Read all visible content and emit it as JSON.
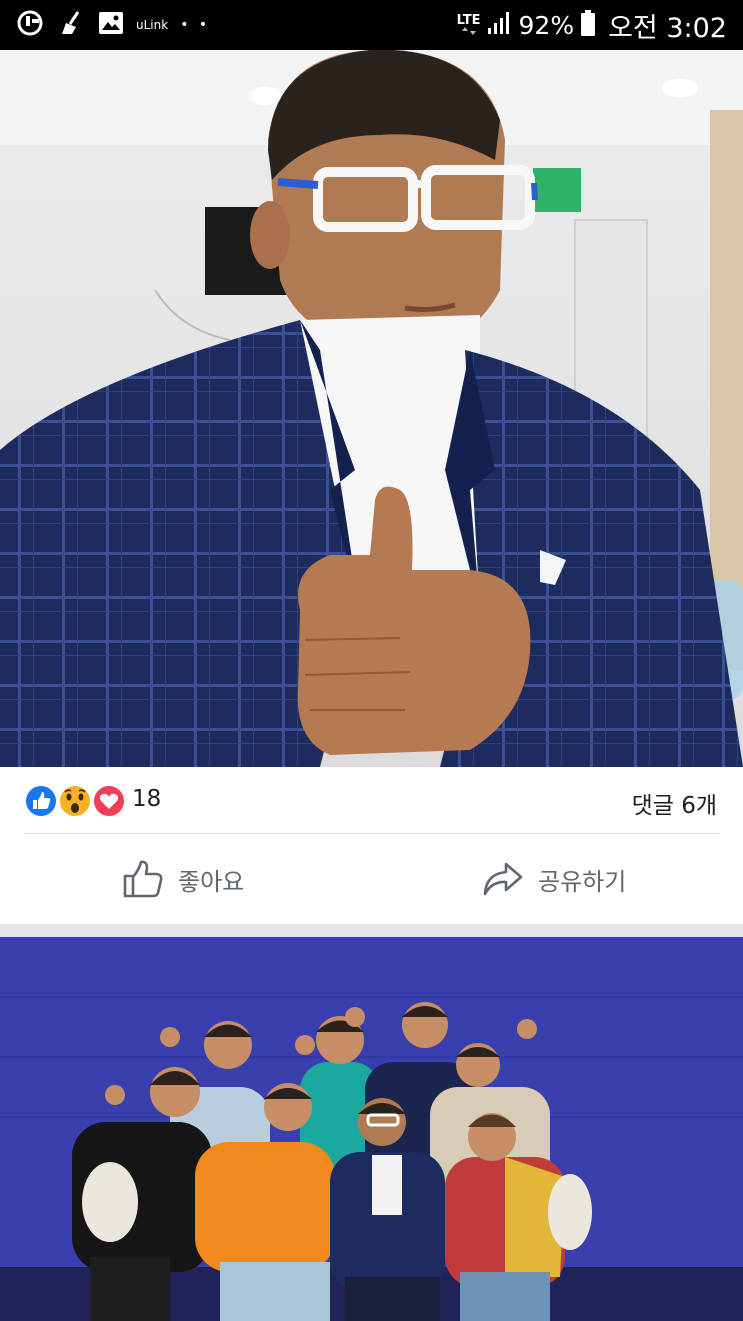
{
  "status_bar": {
    "carrier_label": "uLink",
    "more_dots": "• •",
    "network": "LTE",
    "battery_percent": "92%",
    "time": "오전 3:02"
  },
  "post": {
    "reaction_count": "18",
    "reaction_types": [
      "like",
      "wow",
      "love"
    ],
    "comment_count": "댓글 6개",
    "like_label": "좋아요",
    "share_label": "공유하기"
  },
  "colors": {
    "like_blue": "#1877f2",
    "love_red": "#f33e58",
    "wow_yellow": "#f7b125",
    "action_gray": "#606770",
    "photo2_backdrop": "#3a3fb0"
  }
}
